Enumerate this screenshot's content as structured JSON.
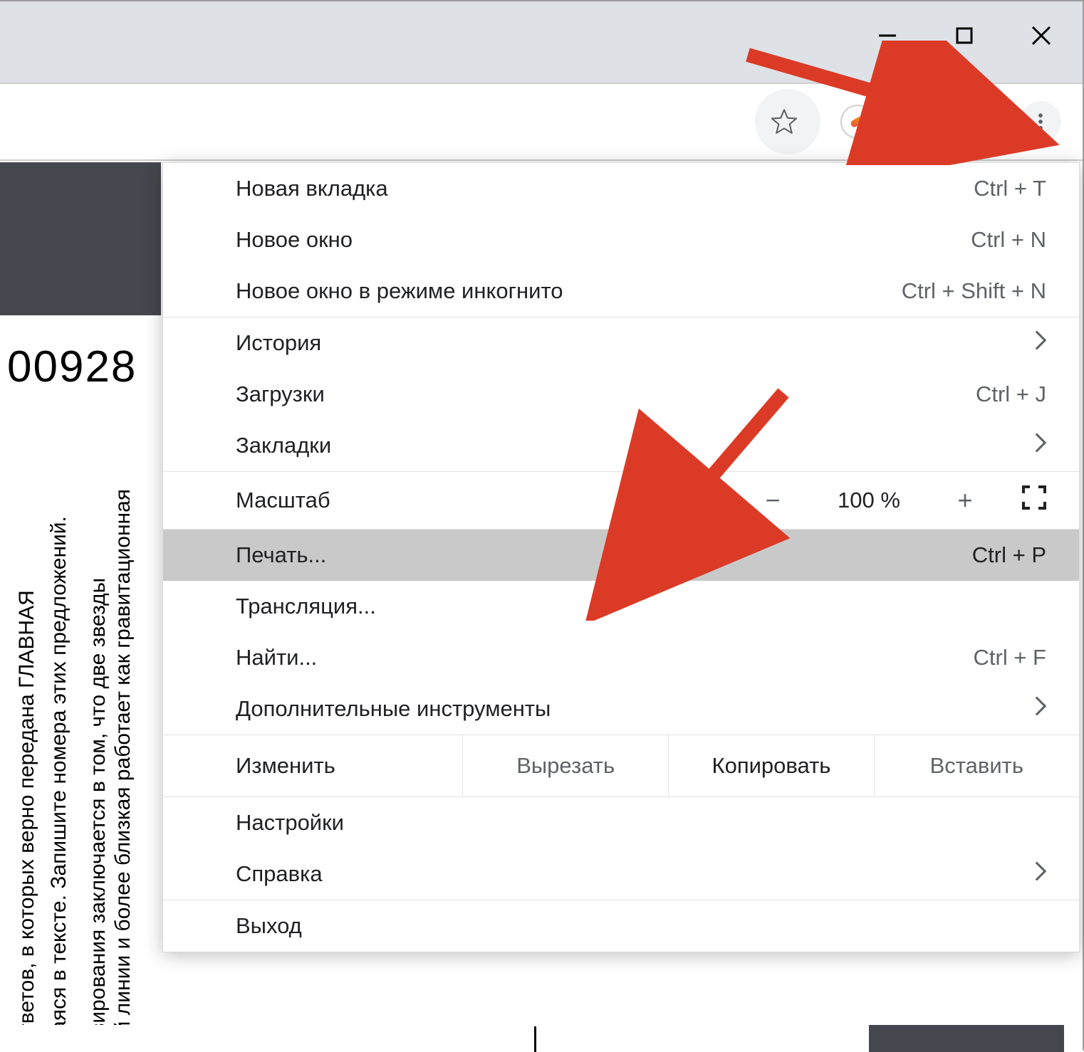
{
  "window_controls": {
    "minimize_glyph": "—",
    "maximize_glyph": "☐",
    "close_glyph": "✕"
  },
  "page": {
    "number_fragment": "00928",
    "vertical_lines": [
      "ответов,  в  которых  верно  передана  ГЛАВНАЯ",
      "цаяся в тексте. Запишите номера этих предложений.",
      "нзирования  заключается  в  том,  что  две  звезды",
      "ой линии и более близкая работает как гравитационная",
      ""
    ]
  },
  "menu": {
    "new_tab": {
      "label": "Новая вкладка",
      "shortcut": "Ctrl + T"
    },
    "new_window": {
      "label": "Новое окно",
      "shortcut": "Ctrl + N"
    },
    "incognito": {
      "label": "Новое окно в режиме инкогнито",
      "shortcut": "Ctrl + Shift + N"
    },
    "history": {
      "label": "История"
    },
    "downloads": {
      "label": "Загрузки",
      "shortcut": "Ctrl + J"
    },
    "bookmarks": {
      "label": "Закладки"
    },
    "zoom": {
      "label": "Масштаб",
      "minus": "−",
      "value": "100 %",
      "plus": "+"
    },
    "print": {
      "label": "Печать...",
      "shortcut": "Ctrl + P"
    },
    "cast": {
      "label": "Трансляция..."
    },
    "find": {
      "label": "Найти...",
      "shortcut": "Ctrl + F"
    },
    "more_tools": {
      "label": "Дополнительные инструменты"
    },
    "edit": {
      "label": "Изменить",
      "cut": "Вырезать",
      "copy": "Копировать",
      "paste": "Вставить"
    },
    "settings": {
      "label": "Настройки"
    },
    "help": {
      "label": "Справка"
    },
    "exit": {
      "label": "Выход"
    }
  }
}
